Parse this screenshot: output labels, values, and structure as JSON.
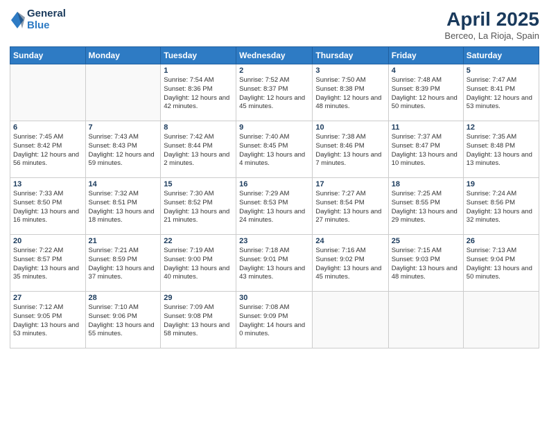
{
  "header": {
    "logo_general": "General",
    "logo_blue": "Blue",
    "month_title": "April 2025",
    "location": "Berceo, La Rioja, Spain"
  },
  "days_of_week": [
    "Sunday",
    "Monday",
    "Tuesday",
    "Wednesday",
    "Thursday",
    "Friday",
    "Saturday"
  ],
  "weeks": [
    [
      {
        "num": "",
        "info": ""
      },
      {
        "num": "",
        "info": ""
      },
      {
        "num": "1",
        "info": "Sunrise: 7:54 AM\nSunset: 8:36 PM\nDaylight: 12 hours and 42 minutes."
      },
      {
        "num": "2",
        "info": "Sunrise: 7:52 AM\nSunset: 8:37 PM\nDaylight: 12 hours and 45 minutes."
      },
      {
        "num": "3",
        "info": "Sunrise: 7:50 AM\nSunset: 8:38 PM\nDaylight: 12 hours and 48 minutes."
      },
      {
        "num": "4",
        "info": "Sunrise: 7:48 AM\nSunset: 8:39 PM\nDaylight: 12 hours and 50 minutes."
      },
      {
        "num": "5",
        "info": "Sunrise: 7:47 AM\nSunset: 8:41 PM\nDaylight: 12 hours and 53 minutes."
      }
    ],
    [
      {
        "num": "6",
        "info": "Sunrise: 7:45 AM\nSunset: 8:42 PM\nDaylight: 12 hours and 56 minutes."
      },
      {
        "num": "7",
        "info": "Sunrise: 7:43 AM\nSunset: 8:43 PM\nDaylight: 12 hours and 59 minutes."
      },
      {
        "num": "8",
        "info": "Sunrise: 7:42 AM\nSunset: 8:44 PM\nDaylight: 13 hours and 2 minutes."
      },
      {
        "num": "9",
        "info": "Sunrise: 7:40 AM\nSunset: 8:45 PM\nDaylight: 13 hours and 4 minutes."
      },
      {
        "num": "10",
        "info": "Sunrise: 7:38 AM\nSunset: 8:46 PM\nDaylight: 13 hours and 7 minutes."
      },
      {
        "num": "11",
        "info": "Sunrise: 7:37 AM\nSunset: 8:47 PM\nDaylight: 13 hours and 10 minutes."
      },
      {
        "num": "12",
        "info": "Sunrise: 7:35 AM\nSunset: 8:48 PM\nDaylight: 13 hours and 13 minutes."
      }
    ],
    [
      {
        "num": "13",
        "info": "Sunrise: 7:33 AM\nSunset: 8:50 PM\nDaylight: 13 hours and 16 minutes."
      },
      {
        "num": "14",
        "info": "Sunrise: 7:32 AM\nSunset: 8:51 PM\nDaylight: 13 hours and 18 minutes."
      },
      {
        "num": "15",
        "info": "Sunrise: 7:30 AM\nSunset: 8:52 PM\nDaylight: 13 hours and 21 minutes."
      },
      {
        "num": "16",
        "info": "Sunrise: 7:29 AM\nSunset: 8:53 PM\nDaylight: 13 hours and 24 minutes."
      },
      {
        "num": "17",
        "info": "Sunrise: 7:27 AM\nSunset: 8:54 PM\nDaylight: 13 hours and 27 minutes."
      },
      {
        "num": "18",
        "info": "Sunrise: 7:25 AM\nSunset: 8:55 PM\nDaylight: 13 hours and 29 minutes."
      },
      {
        "num": "19",
        "info": "Sunrise: 7:24 AM\nSunset: 8:56 PM\nDaylight: 13 hours and 32 minutes."
      }
    ],
    [
      {
        "num": "20",
        "info": "Sunrise: 7:22 AM\nSunset: 8:57 PM\nDaylight: 13 hours and 35 minutes."
      },
      {
        "num": "21",
        "info": "Sunrise: 7:21 AM\nSunset: 8:59 PM\nDaylight: 13 hours and 37 minutes."
      },
      {
        "num": "22",
        "info": "Sunrise: 7:19 AM\nSunset: 9:00 PM\nDaylight: 13 hours and 40 minutes."
      },
      {
        "num": "23",
        "info": "Sunrise: 7:18 AM\nSunset: 9:01 PM\nDaylight: 13 hours and 43 minutes."
      },
      {
        "num": "24",
        "info": "Sunrise: 7:16 AM\nSunset: 9:02 PM\nDaylight: 13 hours and 45 minutes."
      },
      {
        "num": "25",
        "info": "Sunrise: 7:15 AM\nSunset: 9:03 PM\nDaylight: 13 hours and 48 minutes."
      },
      {
        "num": "26",
        "info": "Sunrise: 7:13 AM\nSunset: 9:04 PM\nDaylight: 13 hours and 50 minutes."
      }
    ],
    [
      {
        "num": "27",
        "info": "Sunrise: 7:12 AM\nSunset: 9:05 PM\nDaylight: 13 hours and 53 minutes."
      },
      {
        "num": "28",
        "info": "Sunrise: 7:10 AM\nSunset: 9:06 PM\nDaylight: 13 hours and 55 minutes."
      },
      {
        "num": "29",
        "info": "Sunrise: 7:09 AM\nSunset: 9:08 PM\nDaylight: 13 hours and 58 minutes."
      },
      {
        "num": "30",
        "info": "Sunrise: 7:08 AM\nSunset: 9:09 PM\nDaylight: 14 hours and 0 minutes."
      },
      {
        "num": "",
        "info": ""
      },
      {
        "num": "",
        "info": ""
      },
      {
        "num": "",
        "info": ""
      }
    ]
  ]
}
